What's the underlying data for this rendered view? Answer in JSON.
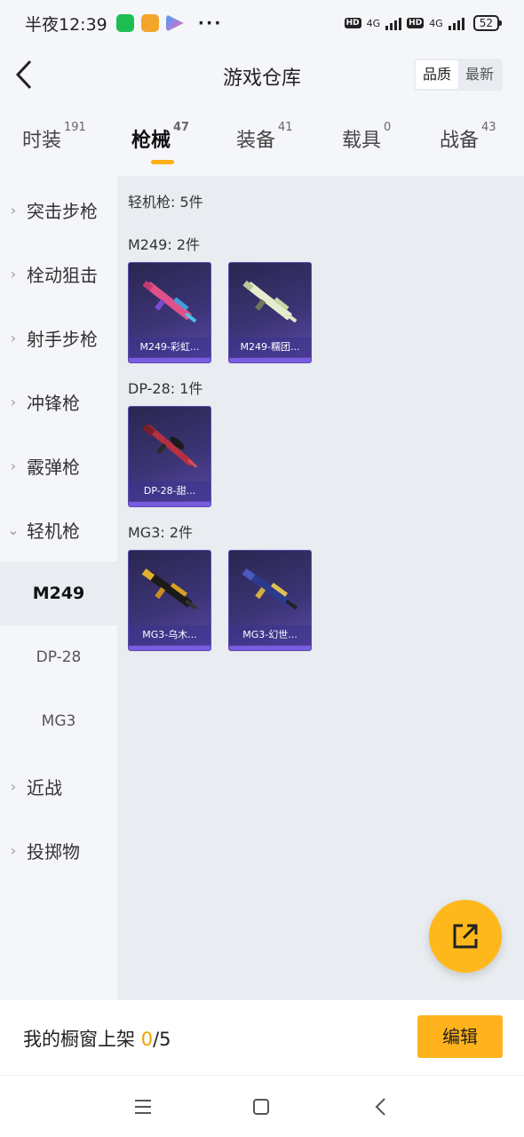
{
  "status_bar": {
    "time": "半夜12:39",
    "more": "···",
    "hd1": "HD",
    "net1": "4G",
    "hd2": "HD",
    "net2": "4G",
    "battery": "52"
  },
  "header": {
    "title": "游戏仓库",
    "sort_options": [
      "品质",
      "最新"
    ],
    "sort_selected": "品质"
  },
  "tabs": [
    {
      "label": "时装",
      "count": "191"
    },
    {
      "label": "枪械",
      "count": "47",
      "active": true
    },
    {
      "label": "装备",
      "count": "41"
    },
    {
      "label": "载具",
      "count": "0"
    },
    {
      "label": "战备",
      "count": "43"
    }
  ],
  "sidebar": {
    "categories": [
      {
        "label": "突击步枪",
        "chevron": ">"
      },
      {
        "label": "栓动狙击",
        "chevron": ">"
      },
      {
        "label": "射手步枪",
        "chevron": ">"
      },
      {
        "label": "冲锋枪",
        "chevron": ">"
      },
      {
        "label": "霰弹枪",
        "chevron": ">"
      },
      {
        "label": "轻机枪",
        "chevron": "v",
        "expanded": true
      }
    ],
    "subcategories": [
      {
        "label": "M249",
        "active": true
      },
      {
        "label": "DP-28"
      },
      {
        "label": "MG3"
      }
    ],
    "categories_after": [
      {
        "label": "近战",
        "chevron": ">"
      },
      {
        "label": "投掷物",
        "chevron": ">"
      }
    ]
  },
  "main": {
    "summary": "轻机枪: 5件",
    "groups": [
      {
        "title": "M249: 2件",
        "items": [
          "M249-彩虹...",
          "M249-糯团..."
        ]
      },
      {
        "title": "DP-28: 1件",
        "items": [
          "DP-28-甜..."
        ]
      },
      {
        "title": "MG3: 2件",
        "items": [
          "MG3-乌木...",
          "MG3-幻世..."
        ]
      }
    ]
  },
  "bottom": {
    "label": "我的橱窗上架",
    "count_current": "0",
    "count_total": "/5",
    "edit": "编辑"
  },
  "colors": {
    "accent": "#ffb21c",
    "card_bg": "#3c3475"
  },
  "icons": {
    "fab": "share-external-icon",
    "back": "back-arrow-icon"
  }
}
